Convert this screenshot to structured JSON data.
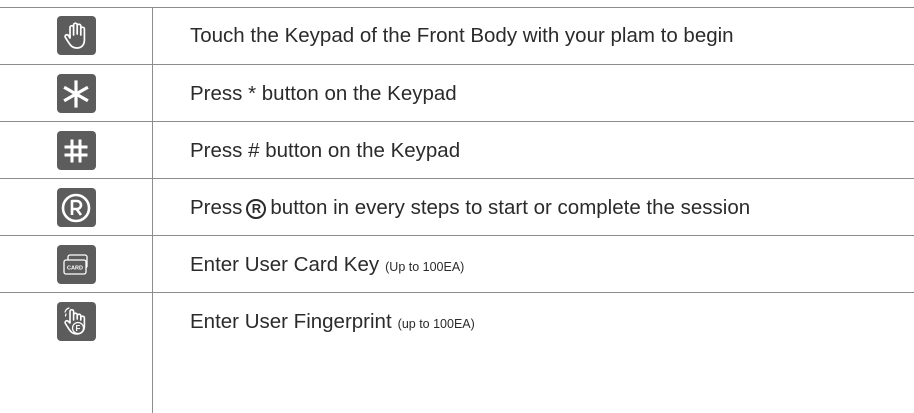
{
  "rows": [
    {
      "icon": "palm-touch-icon",
      "text": "Touch the Keypad of the Front Body with your plam to begin"
    },
    {
      "icon": "asterisk-key-icon",
      "text": "Press * button on the Keypad"
    },
    {
      "icon": "hash-key-icon",
      "text": "Press # button on the Keypad"
    },
    {
      "icon": "r-button-icon",
      "text_before": "Press",
      "r_symbol": "R",
      "text_after": "button in every steps to start or complete the session"
    },
    {
      "icon": "card-key-icon",
      "icon_label": "CARD",
      "text": "Enter User Card Key",
      "note": "(Up to 100EA)"
    },
    {
      "icon": "fingerprint-icon",
      "icon_label": "F",
      "text": "Enter User Fingerprint",
      "note": "(up to 100EA)"
    }
  ],
  "colors": {
    "icon_bg": "#5c5c5c",
    "icon_fg": "#ffffff",
    "text": "#2b2b2b",
    "rule": "#8d8d8d"
  }
}
